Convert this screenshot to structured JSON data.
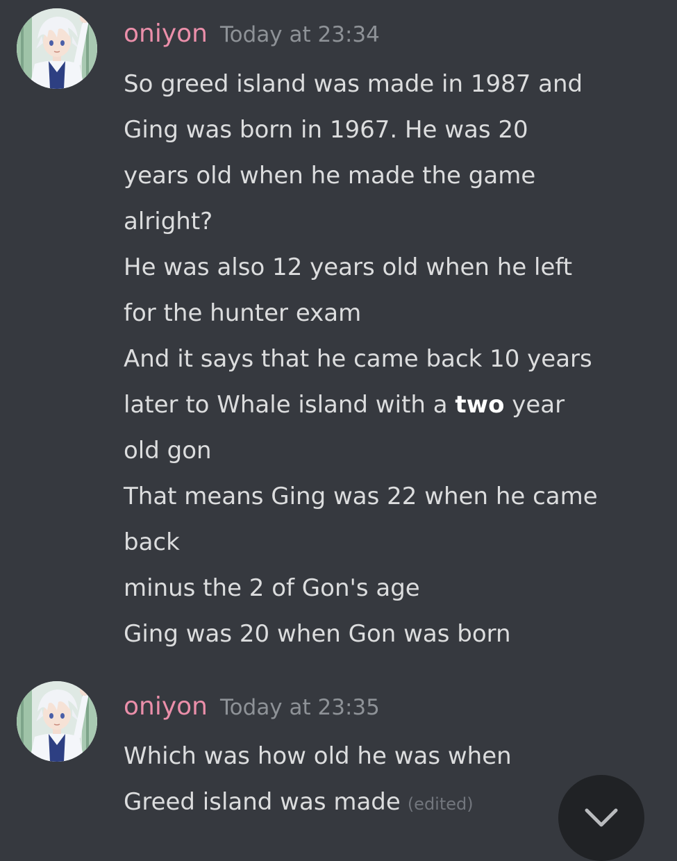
{
  "colors": {
    "background": "#36393f",
    "username": "#eb8faa",
    "timestamp": "#8e9297",
    "message_text": "#dcddde",
    "edited_tag": "#72767d",
    "scroll_button": "#202225"
  },
  "messages": [
    {
      "author": "oniyon",
      "timestamp": "Today at 23:34",
      "avatar_icon": "user-avatar-icon",
      "lines": [
        "So greed island was made in 1987 and",
        "Ging was born in 1967. He was 20",
        "years old when he made the game",
        "alright?",
        "He was also 12 years old when he left",
        "for the hunter exam",
        "And it says that he came back 10 years",
        {
          "before": "later to Whale island with a ",
          "bold": "two",
          "after": " year"
        },
        "old gon",
        "That means Ging was 22 when he came",
        "back",
        "minus the 2 of Gon's age",
        "Ging was 20 when Gon was born"
      ]
    },
    {
      "author": "oniyon",
      "timestamp": "Today at 23:35",
      "avatar_icon": "user-avatar-icon",
      "lines": [
        "Which was how old he was when",
        "Greed island was made"
      ],
      "edited_label": "(edited)"
    }
  ],
  "scroll_button_icon": "chevron-down-icon"
}
